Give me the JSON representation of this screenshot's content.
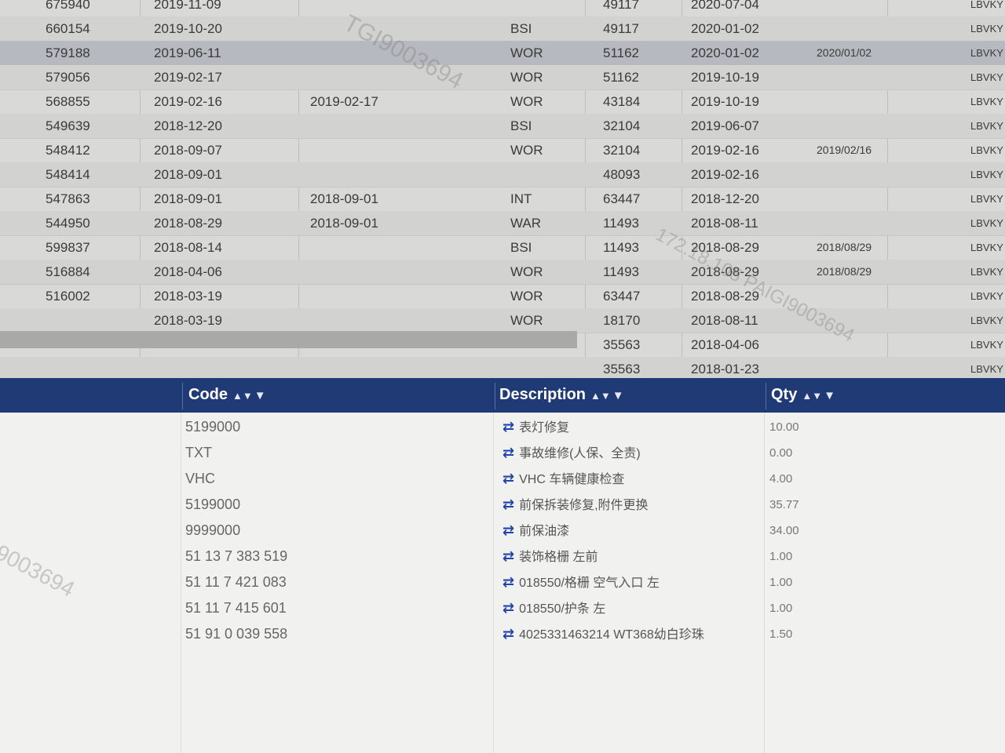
{
  "history": {
    "rows": [
      {
        "id": "675940",
        "date": "2019-11-09",
        "date2": "",
        "type": "",
        "num": "49117",
        "date3": "2020-07-04",
        "date4": "",
        "vin": "LBVKY"
      },
      {
        "id": "660154",
        "date": "2019-10-20",
        "date2": "",
        "type": "BSI",
        "num": "49117",
        "date3": "2020-01-02",
        "date4": "",
        "vin": "LBVKY"
      },
      {
        "id": "579188",
        "date": "2019-06-11",
        "date2": "",
        "type": "WOR",
        "num": "51162",
        "date3": "2020-01-02",
        "date4": "2020/01/02",
        "vin": "LBVKY"
      },
      {
        "id": "579056",
        "date": "2019-02-17",
        "date2": "",
        "type": "WOR",
        "num": "51162",
        "date3": "2019-10-19",
        "date4": "",
        "vin": "LBVKY"
      },
      {
        "id": "568855",
        "date": "2019-02-16",
        "date2": "2019-02-17",
        "type": "WOR",
        "num": "43184",
        "date3": "2019-10-19",
        "date4": "",
        "vin": "LBVKY"
      },
      {
        "id": "549639",
        "date": "2018-12-20",
        "date2": "",
        "type": "BSI",
        "num": "32104",
        "date3": "2019-06-07",
        "date4": "",
        "vin": "LBVKY"
      },
      {
        "id": "548412",
        "date": "2018-09-07",
        "date2": "",
        "type": "WOR",
        "num": "32104",
        "date3": "2019-02-16",
        "date4": "2019/02/16",
        "vin": "LBVKY"
      },
      {
        "id": "548414",
        "date": "2018-09-01",
        "date2": "",
        "type": "",
        "num": "48093",
        "date3": "2019-02-16",
        "date4": "",
        "vin": "LBVKY"
      },
      {
        "id": "547863",
        "date": "2018-09-01",
        "date2": "2018-09-01",
        "type": "INT",
        "num": "63447",
        "date3": "2018-12-20",
        "date4": "",
        "vin": "LBVKY"
      },
      {
        "id": "544950",
        "date": "2018-08-29",
        "date2": "2018-09-01",
        "type": "WAR",
        "num": "11493",
        "date3": "2018-08-11",
        "date4": "",
        "vin": "LBVKY"
      },
      {
        "id": "599837",
        "date": "2018-08-14",
        "date2": "",
        "type": "BSI",
        "num": "11493",
        "date3": "2018-08-29",
        "date4": "2018/08/29",
        "vin": "LBVKY"
      },
      {
        "id": "516884",
        "date": "2018-04-06",
        "date2": "",
        "type": "WOR",
        "num": "11493",
        "date3": "2018-08-29",
        "date4": "2018/08/29",
        "vin": "LBVKY"
      },
      {
        "id": "516002",
        "date": "2018-03-19",
        "date2": "",
        "type": "WOR",
        "num": "63447",
        "date3": "2018-08-29",
        "date4": "",
        "vin": "LBVKY"
      },
      {
        "id": "",
        "date": "2018-03-19",
        "date2": "",
        "type": "WOR",
        "num": "18170",
        "date3": "2018-08-11",
        "date4": "",
        "vin": "LBVKY"
      },
      {
        "id": "",
        "date": "",
        "date2": "",
        "type": "",
        "num": "35563",
        "date3": "2018-04-06",
        "date4": "",
        "vin": "LBVKY"
      },
      {
        "id": "",
        "date": "",
        "date2": "",
        "type": "",
        "num": "35563",
        "date3": "2018-01-23",
        "date4": "",
        "vin": "LBVKY"
      }
    ]
  },
  "watermarks": [
    "TGI9003694",
    "172.18.105 PAIGI9003694",
    "9003694"
  ],
  "parts": {
    "headers": {
      "code": "Code",
      "description": "Description",
      "qty": "Qty"
    },
    "rows": [
      {
        "code": "5199000",
        "desc": "表灯修复",
        "qty": "10.00"
      },
      {
        "code": "TXT",
        "desc": "事故维修(人保、全责)",
        "qty": "0.00"
      },
      {
        "code": "VHC",
        "desc": "VHC 车辆健康检查",
        "qty": "4.00"
      },
      {
        "code": "5199000",
        "desc": "前保拆装修复,附件更换",
        "qty": "35.77"
      },
      {
        "code": "9999000",
        "desc": "前保油漆",
        "qty": "34.00"
      },
      {
        "code": "51 13 7 383 519",
        "desc": "装饰格栅 左前",
        "qty": "1.00"
      },
      {
        "code": "51 11 7 421 083",
        "desc": "018550/格栅 空气入口 左",
        "qty": "1.00"
      },
      {
        "code": "51 11 7 415 601",
        "desc": "018550/护条 左",
        "qty": "1.00"
      },
      {
        "code": "51 91 0 039 558",
        "desc": "4025331463214 WT368幼白珍珠",
        "qty": "1.50"
      }
    ]
  },
  "colors": {
    "header_bg": "#1f3a74",
    "swap_icon": "#2244aa"
  }
}
